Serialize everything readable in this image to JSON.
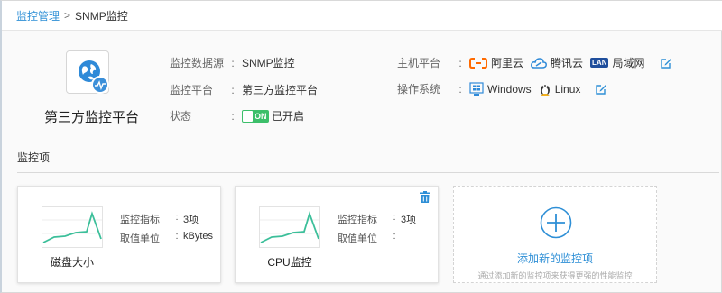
{
  "breadcrumb": {
    "parent": "监控管理",
    "separator": ">",
    "current": "SNMP监控"
  },
  "source": {
    "title": "第三方监控平台",
    "fields": {
      "datasource_label": "监控数据源",
      "datasource_value": "SNMP监控",
      "platform_label": "监控平台",
      "platform_value": "第三方监控平台",
      "status_label": "状态",
      "status_toggle": "ON",
      "status_value": "已开启",
      "host_label": "主机平台",
      "os_label": "操作系统",
      "colon": ":"
    },
    "hosts": [
      {
        "icon": "aliyun-icon",
        "label": "阿里云"
      },
      {
        "icon": "tencent-cloud-icon",
        "label": "腾讯云"
      },
      {
        "icon": "lan-icon",
        "badge": "LAN",
        "label": "局域网"
      }
    ],
    "os": [
      {
        "icon": "windows-icon",
        "label": "Windows"
      },
      {
        "icon": "linux-icon",
        "label": "Linux"
      }
    ]
  },
  "section": {
    "title": "监控项"
  },
  "cards": [
    {
      "name": "磁盘大小",
      "metric_label": "监控指标",
      "metric_value": "3项",
      "unit_label": "取值单位",
      "unit_value": "kBytes"
    },
    {
      "name": "CPU监控",
      "metric_label": "监控指标",
      "metric_value": "3项",
      "unit_label": "取值单位",
      "unit_value": ""
    }
  ],
  "add_card": {
    "label": "添加新的监控项",
    "description": "通过添加新的监控项来获得更强的性能监控"
  },
  "colors": {
    "accent": "#2e8fd6",
    "toggle_on": "#3cbf6a",
    "spark": "#3cbf9a",
    "aliyun": "#ff6a00"
  }
}
